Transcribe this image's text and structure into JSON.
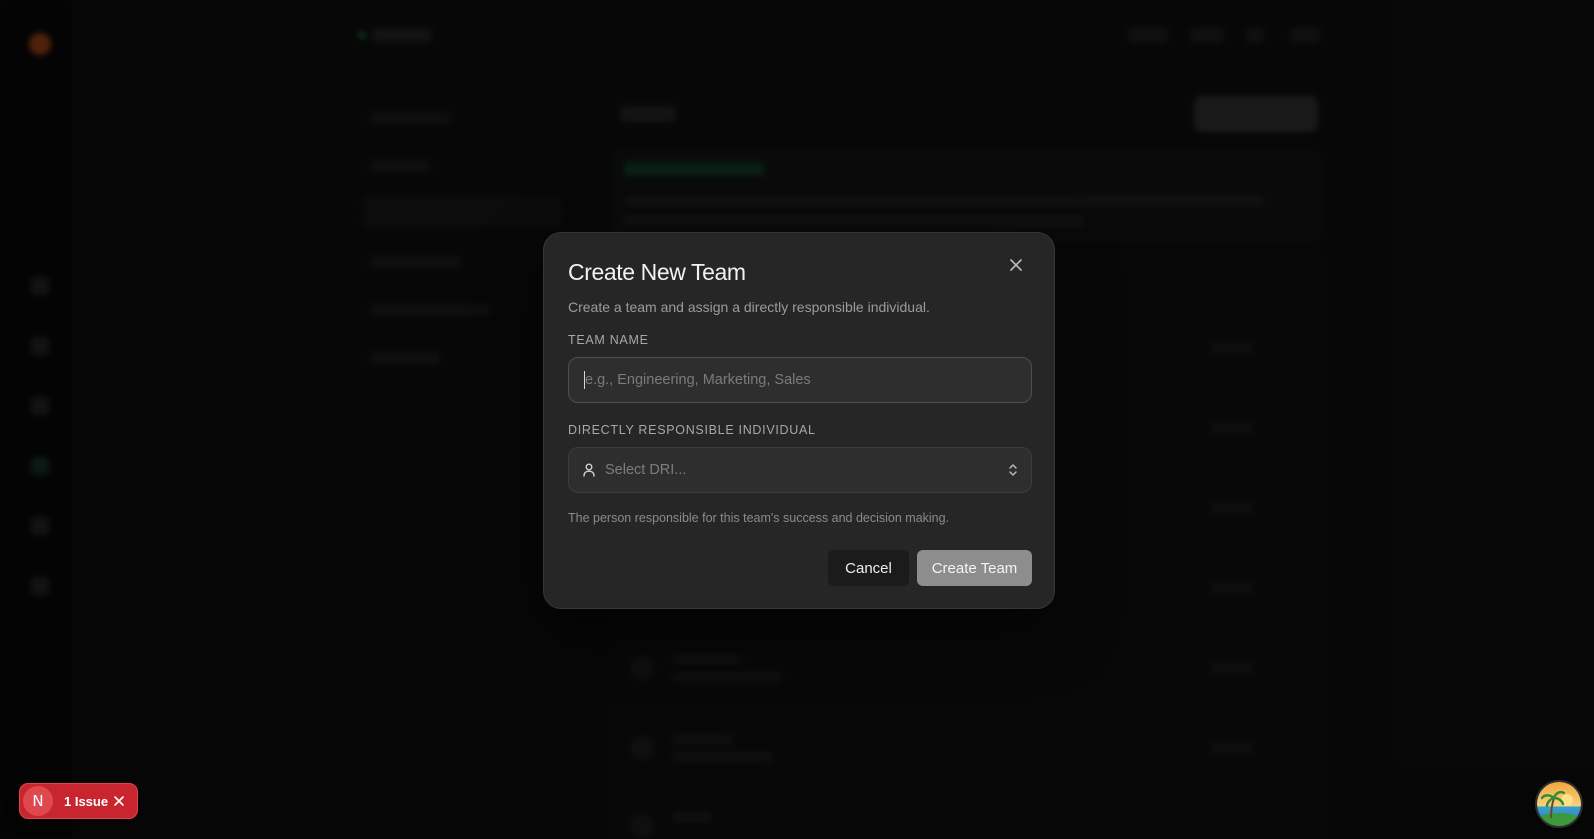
{
  "modal": {
    "title": "Create New Team",
    "description": "Create a team and assign a directly responsible individual.",
    "close_icon": "close-icon",
    "team_name": {
      "label": "TEAM NAME",
      "value": "",
      "placeholder": "e.g., Engineering, Marketing, Sales"
    },
    "dri": {
      "label": "DIRECTLY RESPONSIBLE INDIVIDUAL",
      "placeholder": "Select DRI...",
      "icon": "user-icon",
      "chevron_icon": "chevron-up-down-icon",
      "helper": "The person responsible for this team's success and decision making."
    },
    "cancel_label": "Cancel",
    "create_label": "Create Team"
  },
  "issue_badge": {
    "logo_letter": "N",
    "text": "1 Issue",
    "close_icon": "close-icon"
  },
  "colors": {
    "modal_bg": "#262626",
    "badge_red": "#c9252e",
    "primary_button": "#8d8d8d",
    "accent_green": "#1f6b3b"
  }
}
